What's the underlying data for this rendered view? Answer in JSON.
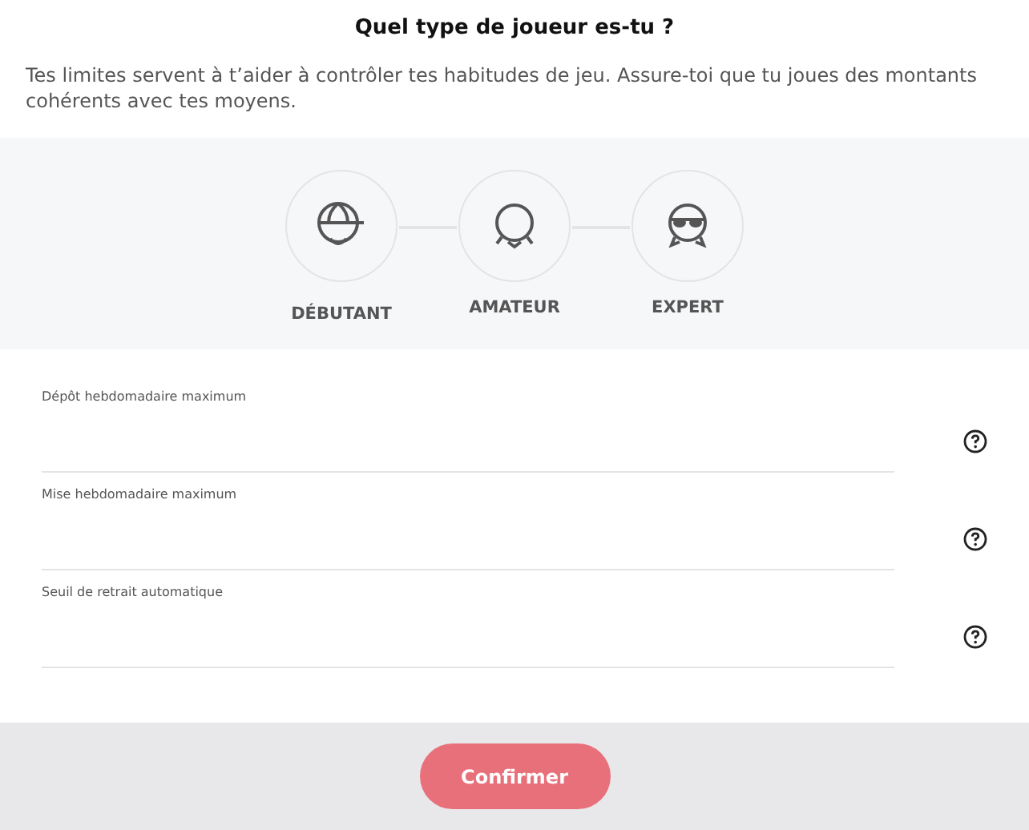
{
  "title": "Quel type de joueur es-tu ?",
  "description": "Tes limites servent à t’aider à contrôler tes habitudes de jeu. Assure-toi que tu joues des montants cohérents avec tes moyens.",
  "levels": [
    {
      "label": "DÉBUTANT",
      "kind": "cap"
    },
    {
      "label": "AMATEUR",
      "kind": "collar"
    },
    {
      "label": "EXPERT",
      "kind": "sunglasses"
    }
  ],
  "fields": [
    {
      "label": "Dépôt hebdomadaire maximum"
    },
    {
      "label": "Mise hebdomadaire maximum"
    },
    {
      "label": "Seuil de retrait automatique"
    }
  ],
  "confirm_button": "Confirmer"
}
